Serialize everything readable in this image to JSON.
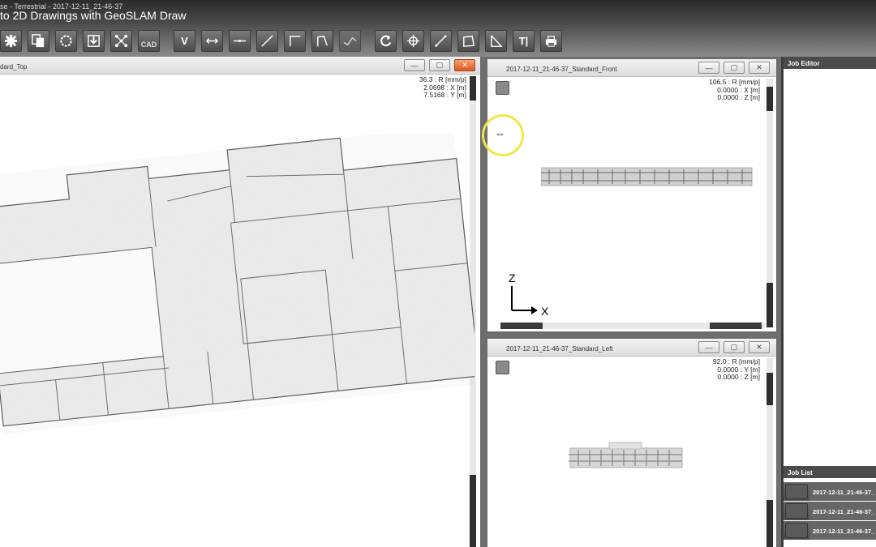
{
  "window": {
    "title": "se - Terrestrial - 2017-12-11_21-46-37"
  },
  "video": {
    "title": "to 2D Drawings with GeoSLAM Draw"
  },
  "toolbar": {
    "cad_label": "CAD",
    "v_label": "V",
    "text_label": "T|",
    "buttons": [
      "settings",
      "copy-layers",
      "circle",
      "import",
      "network",
      "cad",
      "vertical",
      "horizontal-dim",
      "horizontal-line",
      "diagonal-line",
      "corner",
      "polyline",
      "curve",
      "rotate",
      "crosshair",
      "line-tool",
      "rectangle",
      "angle",
      "text",
      "print"
    ]
  },
  "top_view": {
    "title": "dard_Top",
    "readout": [
      "36.3 : R [mm/p]",
      "2.0698 : X [m]",
      "7.5168 : Y [m]"
    ]
  },
  "front_view": {
    "title": "2017-12-11_21-46-37_Standard_Front",
    "readout": [
      "106.5 : R [mm/p]",
      "0.0000 : X [m]",
      "0.0000 : Z [m]"
    ],
    "axis_z": "Z",
    "axis_x": "X"
  },
  "left_view": {
    "title": "2017-12-11_21-46-37_Standard_Left",
    "readout": [
      "92.0 : R [mm/p]",
      "0.0000 : Y [m]",
      "0.0000 : Z [m]"
    ]
  },
  "job_editor": {
    "title": "Job Editor"
  },
  "job_list": {
    "title": "Job List",
    "items": [
      "2017-12-11_21-46-37_",
      "2017-12-11_21-46-37_",
      "2017-12-11_21-46-37_"
    ]
  },
  "colors": {
    "toolbar_bg": "#4a4a4a",
    "close_button": "#dd5a24",
    "panel_header": "#e6e6e6",
    "cursor_highlight": "#f2e64a"
  }
}
